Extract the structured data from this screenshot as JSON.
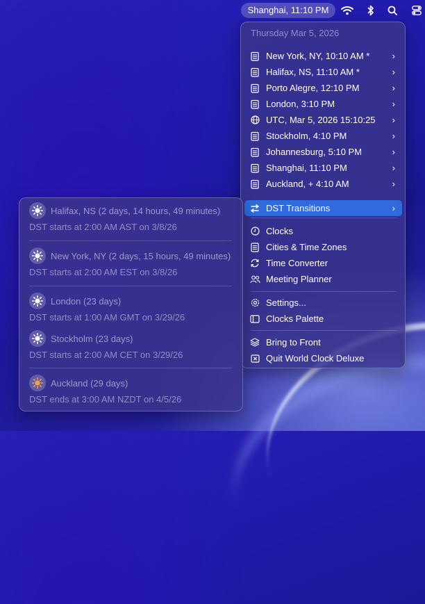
{
  "menubar": {
    "clock": "Shanghai, 11:10 PM",
    "icons": [
      "wifi-icon",
      "bluetooth-icon",
      "search-icon",
      "control-center-icon"
    ]
  },
  "menu": {
    "date": "Thursday Mar 5, 2026",
    "cities": [
      {
        "label": "New York, NY, 10:10 AM *",
        "icon": "calendar-icon"
      },
      {
        "label": "Halifax, NS, 11:10 AM *",
        "icon": "calendar-icon"
      },
      {
        "label": "Porto Alegre, 12:10 PM",
        "icon": "calendar-icon"
      },
      {
        "label": "London, 3:10 PM",
        "icon": "calendar-icon"
      },
      {
        "label": "UTC, Mar 5, 2026 15:10:25",
        "icon": "globe-icon"
      },
      {
        "label": "Stockholm, 4:10 PM",
        "icon": "calendar-icon"
      },
      {
        "label": "Johannesburg, 5:10 PM",
        "icon": "calendar-icon"
      },
      {
        "label": "Shanghai, 11:10 PM",
        "icon": "calendar-icon"
      },
      {
        "label": "Auckland, + 4:10 AM",
        "icon": "calendar-icon"
      }
    ],
    "dst": "DST Transitions",
    "tools": [
      {
        "label": "Clocks",
        "icon": "clock-icon"
      },
      {
        "label": "Cities & Time Zones",
        "icon": "document-icon"
      },
      {
        "label": "Time Converter",
        "icon": "convert-icon"
      },
      {
        "label": "Meeting Planner",
        "icon": "people-icon"
      }
    ],
    "settings": [
      {
        "label": "Settings...",
        "icon": "gear-icon"
      },
      {
        "label": "Clocks Palette",
        "icon": "palette-icon"
      }
    ],
    "window": [
      {
        "label": "Bring to Front",
        "icon": "layers-icon"
      },
      {
        "label": "Quit World Clock Deluxe",
        "icon": "quit-icon"
      }
    ]
  },
  "dst_submenu": [
    {
      "title": "Halifax, NS (2 days, 14 hours, 49 minutes)",
      "detail": "DST starts at 2:00 AM AST on 3/8/26",
      "icon": "sun-icon"
    },
    {
      "title": "New York, NY (2 days, 15 hours, 49 minutes)",
      "detail": "DST starts at 2:00 AM EST on 3/8/26",
      "icon": "sun-icon"
    },
    {
      "title": "London (23 days)",
      "detail": "DST starts at 1:00 AM GMT on 3/29/26",
      "icon": "sun-icon"
    },
    {
      "title": "Stockholm (23 days)",
      "detail": "DST starts at 2:00 AM CET on 3/29/26",
      "icon": "sun-icon"
    },
    {
      "title": "Auckland (29 days)",
      "detail": "DST ends at 3:00 AM NZDT on 4/5/26",
      "icon": "sun-orange-icon"
    }
  ],
  "colors": {
    "highlight": "#2f6bdc",
    "sun_orange": "#f4a23c"
  }
}
